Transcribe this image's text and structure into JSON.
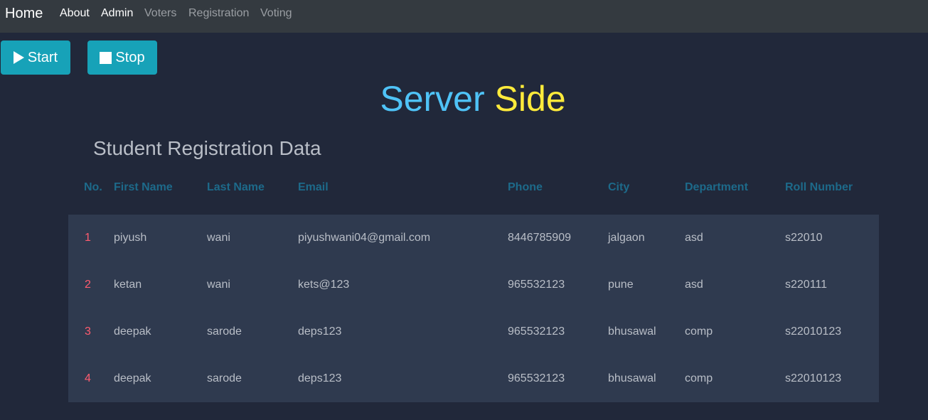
{
  "navbar": {
    "brand": "Home",
    "links": [
      {
        "label": "About",
        "active": true
      },
      {
        "label": "Admin",
        "active": true
      },
      {
        "label": "Voters",
        "active": false
      },
      {
        "label": "Registration",
        "active": false
      },
      {
        "label": "Voting",
        "active": false
      }
    ]
  },
  "controls": {
    "start_label": "Start",
    "start_icon": "play-icon",
    "stop_label": "Stop",
    "stop_icon": "stop-icon",
    "button_color": "#17a2b8"
  },
  "title": {
    "word1": "Server",
    "word2": "Side",
    "word1_color": "#4fc3f7",
    "word2_color": "#ffeb3b"
  },
  "table": {
    "heading": "Student Registration Data",
    "columns": [
      "No.",
      "First Name",
      "Last Name",
      "Email",
      "Phone",
      "City",
      "Department",
      "Roll Number"
    ],
    "rows": [
      [
        "1",
        "piyush",
        "wani",
        "piyushwani04@gmail.com",
        "8446785909",
        "jalgaon",
        "asd",
        "s22010"
      ],
      [
        "2",
        "ketan",
        "wani",
        "kets@123",
        "965532123",
        "pune",
        "asd",
        "s220111"
      ],
      [
        "3",
        "deepak",
        "sarode",
        "deps123",
        "965532123",
        "bhusawal",
        "comp",
        "s22010123"
      ],
      [
        "4",
        "deepak",
        "sarode",
        "deps123",
        "965532123",
        "bhusawal",
        "comp",
        "s22010123"
      ]
    ]
  }
}
